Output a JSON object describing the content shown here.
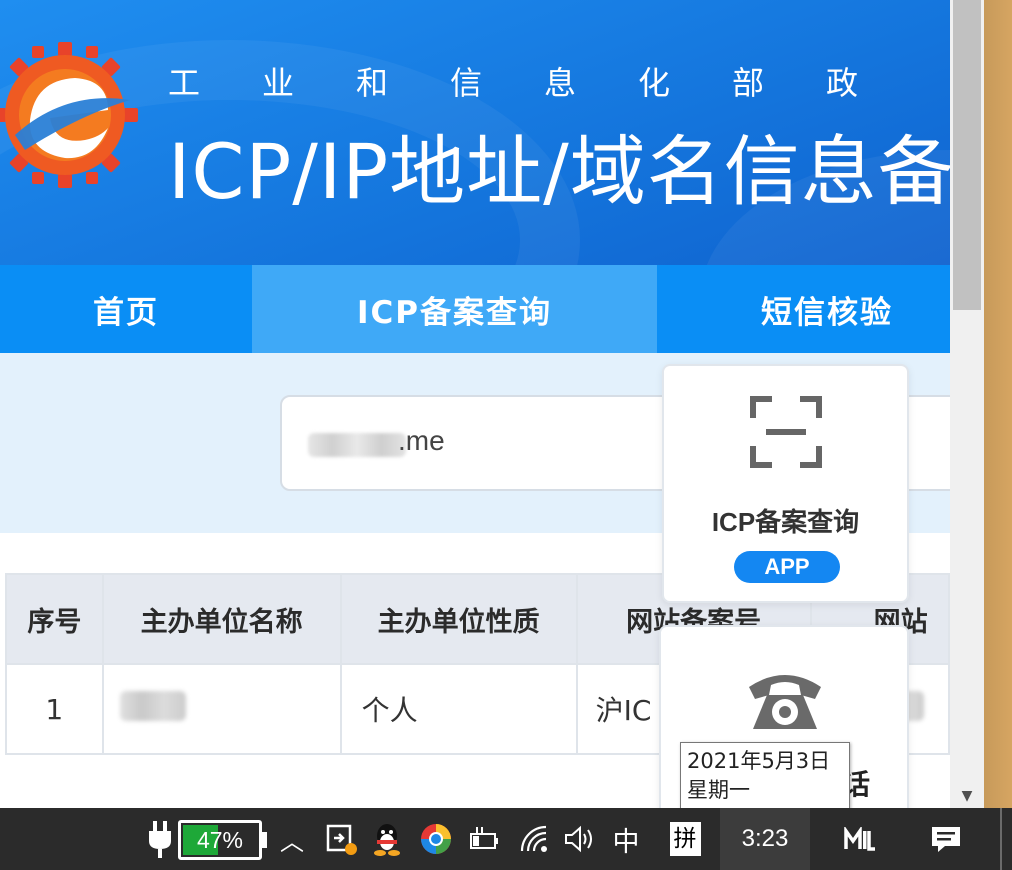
{
  "header": {
    "ministry_text": "工业和信息化部政",
    "site_title": "ICP/IP地址/域名信息备"
  },
  "nav": {
    "items": [
      {
        "label": "首页"
      },
      {
        "label": "ICP备案查询"
      },
      {
        "label": "短信核验"
      }
    ],
    "active_index": 1
  },
  "search": {
    "value_visible": ".me"
  },
  "table": {
    "headers": [
      "序号",
      "主办单位名称",
      "主办单位性质",
      "网站备案号",
      "网站"
    ],
    "rows": [
      {
        "index": "1",
        "org_name": "",
        "org_type": "个人",
        "record_no": "沪IC",
        "site": ""
      }
    ]
  },
  "cards": {
    "app": {
      "title": "ICP备案查询",
      "badge": "APP",
      "icon": "scan-icon"
    },
    "phone": {
      "label": "话",
      "icon": "telephone-icon"
    }
  },
  "tooltip": {
    "date": "2021年5月3日",
    "weekday": "星期一"
  },
  "taskbar": {
    "battery_percent": "47%",
    "battery_level": 0.47,
    "ime_mode": "中",
    "ime_layout": "拼",
    "clock": "3:23"
  },
  "colors": {
    "banner_blue": "#1577de",
    "nav_blue": "#0a8ef5",
    "nav_active": "#3fa9f7",
    "search_bg": "#e3f1fc",
    "badge_blue": "#1487f2",
    "battery_green": "#1ea838",
    "taskbar_bg": "#2b2b2b"
  }
}
